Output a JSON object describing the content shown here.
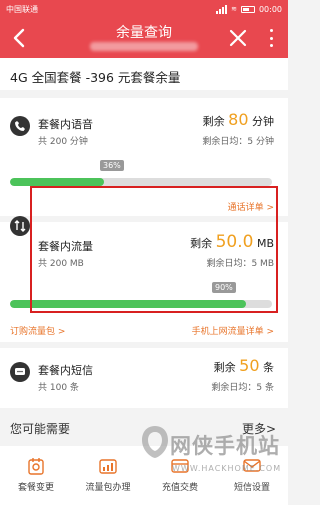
{
  "status_bar": {
    "carrier": "中国联通",
    "time": "00:00"
  },
  "header": {
    "title": "余量查询"
  },
  "plan": {
    "name": "4G 全国套餐 -396 元套餐余量"
  },
  "voice": {
    "title": "套餐内语音",
    "total": "共 200 分钟",
    "remain_label": "剩余",
    "remain_value": "80",
    "remain_unit": "分钟",
    "daily": "剩余日均：5 分钟",
    "used_percent": 36,
    "percent_label": "36%",
    "link": "通话详单 >"
  },
  "data": {
    "title": "套餐内流量",
    "total": "共 200 MB",
    "remain_label": "剩余",
    "remain_value": "50.0",
    "remain_unit": "MB",
    "daily": "剩余日均：5 MB",
    "used_percent": 90,
    "percent_label": "90%",
    "link_left": "订购流量包 >",
    "link_right": "手机上网流量详单 >"
  },
  "sms": {
    "title": "套餐内短信",
    "total": "共 100 条",
    "remain_label": "剩余",
    "remain_value": "50",
    "remain_unit": "条",
    "daily": "剩余日均：5 条"
  },
  "suggest": {
    "title": "您可能需要",
    "more": "更多>"
  },
  "nav": [
    {
      "label": "套餐变更",
      "icon": "package-change-icon"
    },
    {
      "label": "流量包办理",
      "icon": "data-package-icon"
    },
    {
      "label": "充值交费",
      "icon": "recharge-icon"
    },
    {
      "label": "短信设置",
      "icon": "sms-settings-icon"
    }
  ],
  "watermark": {
    "text": "网侠手机站",
    "sub": "WWW.HACKHOME.COM"
  },
  "colors": {
    "accent": "#e8484f",
    "orange": "#f0a020",
    "green": "#4cc35a",
    "highlight": "#d82020"
  }
}
